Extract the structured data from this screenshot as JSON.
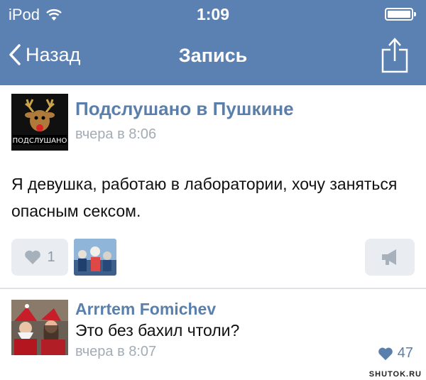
{
  "status_bar": {
    "device": "iPod",
    "time": "1:09"
  },
  "nav": {
    "back_label": "Назад",
    "title": "Запись"
  },
  "post": {
    "author": "Подслушано в Пушкине",
    "avatar_caption": "ПОДСЛУШАНО",
    "time": "вчера в 8:06",
    "text": "Я девушка, работаю в лаборатории, хочу заняться опасным сексом.",
    "likes": "1"
  },
  "comment": {
    "author": "Arrrtem Fomichev",
    "text": "Это без бахил чтоли?",
    "time": "вчера в 8:07",
    "likes": "47"
  },
  "watermark": "SHUTOK.RU",
  "colors": {
    "header": "#5b81b3",
    "link": "#5a7fab",
    "muted": "#a3acb5",
    "button_bg": "#e9edf1"
  }
}
